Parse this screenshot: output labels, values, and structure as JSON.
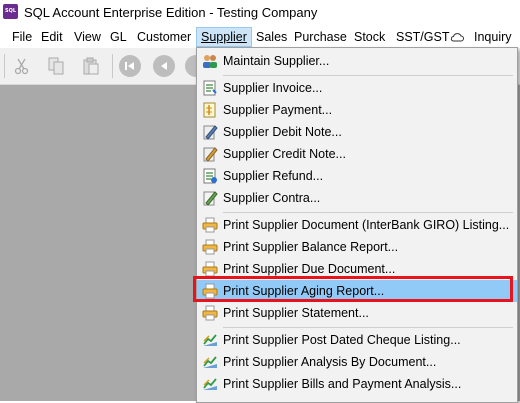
{
  "window": {
    "title": "SQL Account Enterprise Edition - Testing Company",
    "logo_text": "SQL"
  },
  "menubar": {
    "items": [
      {
        "label": "File",
        "mnemonic": "F"
      },
      {
        "label": "Edit",
        "mnemonic": "E"
      },
      {
        "label": "View",
        "mnemonic": "V"
      },
      {
        "label": "GL",
        "mnemonic": "G"
      },
      {
        "label": "Customer",
        "mnemonic": "C"
      },
      {
        "label": "Supplier",
        "mnemonic": "S"
      },
      {
        "label": "Sales",
        "mnemonic": "a"
      },
      {
        "label": "Purchase",
        "mnemonic": "P"
      },
      {
        "label": "Stock",
        "mnemonic": "k"
      },
      {
        "label": "SST/GST",
        "mnemonic": "T"
      },
      {
        "label": "",
        "icon": "cloud-icon"
      },
      {
        "label": "Inquiry",
        "mnemonic": "I"
      }
    ]
  },
  "toolbar": {
    "icons": [
      "cut-icon",
      "copy-icon",
      "paste-icon",
      "first-record-icon",
      "previous-record-icon"
    ]
  },
  "supplier_menu": {
    "items": [
      {
        "label": "Maintain Supplier...",
        "icon": "users-icon"
      },
      {
        "label": "Supplier Invoice...",
        "icon": "invoice-icon"
      },
      {
        "label": "Supplier Payment...",
        "icon": "payment-icon"
      },
      {
        "label": "Supplier Debit Note...",
        "icon": "debit-note-icon"
      },
      {
        "label": "Supplier Credit Note...",
        "icon": "credit-note-icon"
      },
      {
        "label": "Supplier Refund...",
        "icon": "refund-icon"
      },
      {
        "label": "Supplier Contra...",
        "icon": "contra-icon"
      },
      {
        "label": "Print Supplier Document (InterBank GIRO) Listing...",
        "icon": "printer-icon"
      },
      {
        "label": "Print Supplier Balance Report...",
        "icon": "printer-icon"
      },
      {
        "label": "Print Supplier Due Document...",
        "icon": "printer-icon"
      },
      {
        "label": "Print Supplier Aging Report...",
        "icon": "printer-icon",
        "highlighted": true
      },
      {
        "label": "Print Supplier Statement...",
        "icon": "printer-icon"
      },
      {
        "label": "Print Supplier Post Dated Cheque Listing...",
        "icon": "chart-icon"
      },
      {
        "label": "Print Supplier Analysis By Document...",
        "icon": "chart-icon"
      },
      {
        "label": "Print Supplier Bills and Payment Analysis...",
        "icon": "chart-icon"
      }
    ]
  },
  "colors": {
    "highlight": "#91c9f7",
    "annotation_box": "#e8141d",
    "workspace": "#a9a9a9"
  }
}
